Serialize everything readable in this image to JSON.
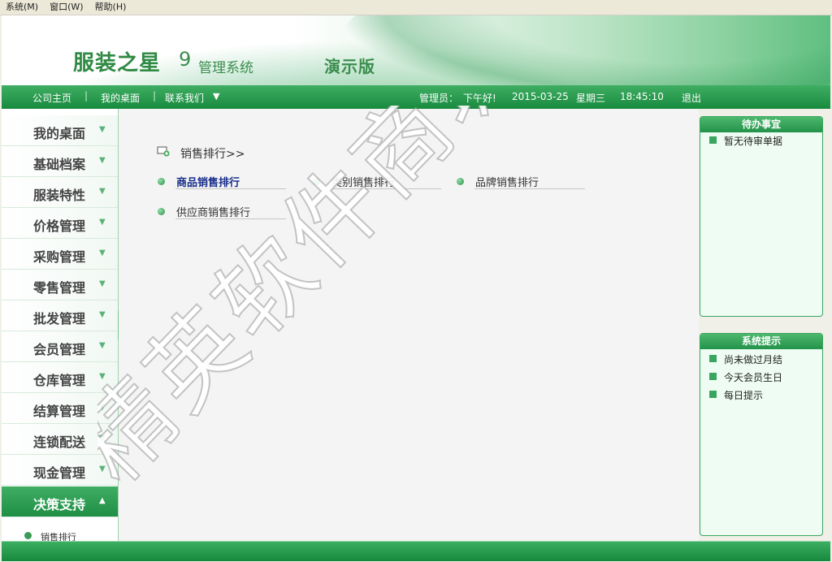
{
  "menu": [
    {
      "label": "系统(M)"
    },
    {
      "label": "窗口(W)"
    },
    {
      "label": "帮助(H)"
    }
  ],
  "banner": {
    "title": "服装之星",
    "version": "9",
    "subtitle": "管理系统",
    "edition": "演示版"
  },
  "nav": {
    "home": "公司主页",
    "desktop": "我的桌面",
    "contact": "联系我们",
    "admin_label": "管理员：",
    "greeting": "下午好!",
    "date": "2015-03-25",
    "weekday": "星期三",
    "time": "18:45:10",
    "logout": "退出"
  },
  "sidebar": {
    "items": [
      {
        "label": "我的桌面"
      },
      {
        "label": "基础档案"
      },
      {
        "label": "服装特性"
      },
      {
        "label": "价格管理"
      },
      {
        "label": "采购管理"
      },
      {
        "label": "零售管理"
      },
      {
        "label": "批发管理"
      },
      {
        "label": "会员管理"
      },
      {
        "label": "仓库管理"
      },
      {
        "label": "结算管理"
      },
      {
        "label": "连锁配送"
      },
      {
        "label": "现金管理"
      },
      {
        "label": "决策支持"
      }
    ],
    "active_sub": "销售排行"
  },
  "main": {
    "section_title": "销售排行>>",
    "rankings": [
      {
        "label": "商品销售排行"
      },
      {
        "label": "类别销售排行"
      },
      {
        "label": "品牌销售排行"
      },
      {
        "label": "供应商销售排行"
      }
    ]
  },
  "watermark": "精英软件商城",
  "panels": {
    "todo": {
      "title": "待办事宜",
      "items": [
        "暂无待审单据"
      ]
    },
    "tips": {
      "title": "系统提示",
      "items": [
        "尚未做过月结",
        "今天会员生日",
        "每日提示"
      ]
    }
  }
}
